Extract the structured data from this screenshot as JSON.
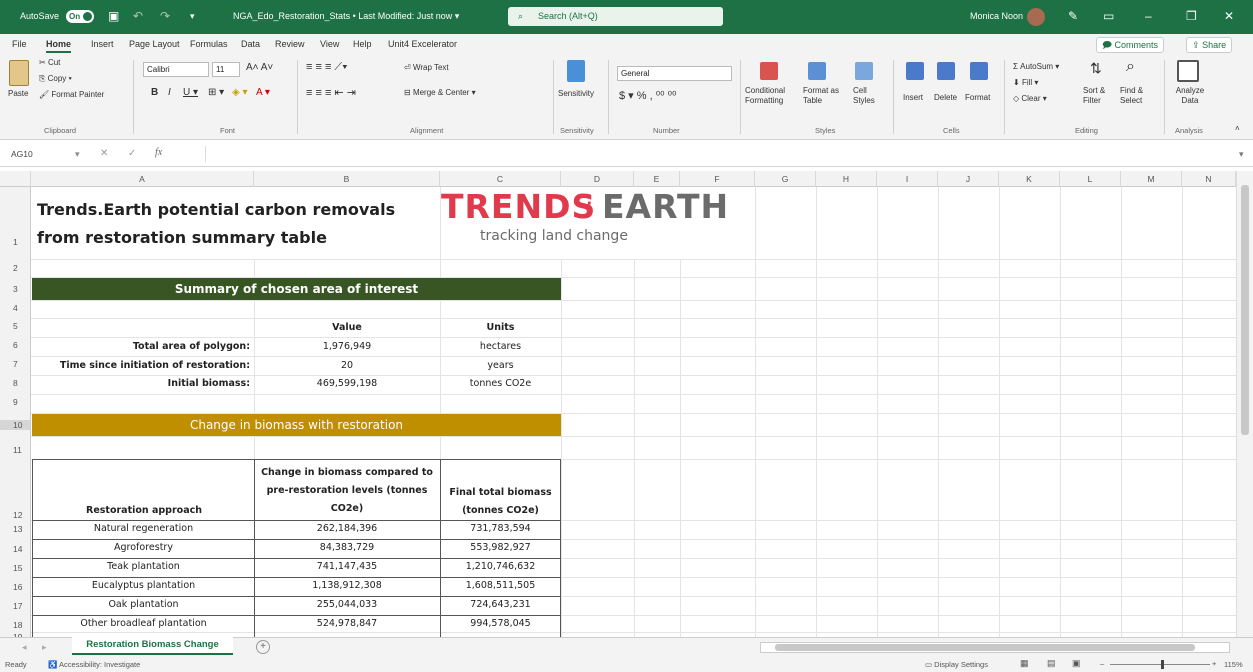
{
  "titlebar": {
    "autosave_label": "AutoSave",
    "autosave_state": "On",
    "doc_title": "NGA_Edo_Restoration_Stats • Last Modified: Just now",
    "search_placeholder": "Search (Alt+Q)",
    "user_name": "Monica Noon"
  },
  "menu": {
    "items": [
      "File",
      "Home",
      "Insert",
      "Page Layout",
      "Formulas",
      "Data",
      "Review",
      "View",
      "Help",
      "Unit4 Excelerator"
    ],
    "comments_label": "Comments",
    "share_label": "Share"
  },
  "ribbon": {
    "clipboard": {
      "paste": "Paste",
      "cut": "Cut",
      "copy": "Copy",
      "format_painter": "Format Painter",
      "group": "Clipboard"
    },
    "font": {
      "name": "Calibri",
      "size": "11",
      "group": "Font"
    },
    "alignment": {
      "wrap": "Wrap Text",
      "merge": "Merge & Center",
      "group": "Alignment"
    },
    "sensitivity": {
      "label": "Sensitivity",
      "group": "Sensitivity"
    },
    "number": {
      "format": "General",
      "group": "Number"
    },
    "styles": {
      "conditional": "Conditional Formatting",
      "format_table": "Format as Table",
      "cell_styles": "Cell Styles",
      "group": "Styles"
    },
    "cells": {
      "insert": "Insert",
      "delete": "Delete",
      "format": "Format",
      "group": "Cells"
    },
    "editing": {
      "autosum": "AutoSum",
      "fill": "Fill",
      "clear": "Clear",
      "sort": "Sort & Filter",
      "find": "Find & Select",
      "group": "Editing"
    },
    "analysis": {
      "analyze": "Analyze Data",
      "group": "Analysis"
    }
  },
  "formula_bar": {
    "name_box": "AG10",
    "formula": ""
  },
  "columns": [
    "A",
    "B",
    "C",
    "D",
    "E",
    "F",
    "G",
    "H",
    "I",
    "J",
    "K",
    "L",
    "M",
    "N"
  ],
  "rows": [
    "1",
    "2",
    "3",
    "4",
    "5",
    "6",
    "7",
    "8",
    "9",
    "10",
    "11",
    "12",
    "13",
    "14",
    "15",
    "16",
    "17",
    "18",
    "19"
  ],
  "sheet": {
    "title_line1": "Trends.Earth potential carbon removals",
    "title_line2": "from restoration summary table",
    "logo_word1": "TRENDS",
    "logo_word2": "EARTH",
    "logo_tagline": "tracking land change",
    "summary_header": "Summary of chosen area of interest",
    "summary_cols": {
      "value": "Value",
      "units": "Units"
    },
    "summary_rows": [
      {
        "label": "Total area of polygon:",
        "value": "1,976,949",
        "units": "hectares"
      },
      {
        "label": "Time since initiation of restoration:",
        "value": "20",
        "units": "years"
      },
      {
        "label": "Initial biomass:",
        "value": "469,599,198",
        "units": "tonnes CO2e"
      }
    ],
    "change_header": "Change in biomass with restoration",
    "change_cols": {
      "approach": "Restoration approach",
      "change": "Change in biomass compared to pre-restoration levels (tonnes CO2e)",
      "final": "Final total biomass (tonnes CO2e)"
    },
    "change_rows": [
      {
        "approach": "Natural regeneration",
        "change": "262,184,396",
        "final": "731,783,594"
      },
      {
        "approach": "Agroforestry",
        "change": "84,383,729",
        "final": "553,982,927"
      },
      {
        "approach": "Teak plantation",
        "change": "741,147,435",
        "final": "1,210,746,632"
      },
      {
        "approach": "Eucalyptus plantation",
        "change": "1,138,912,308",
        "final": "1,608,511,505"
      },
      {
        "approach": "Oak plantation",
        "change": "255,044,033",
        "final": "724,643,231"
      },
      {
        "approach": "Other broadleaf plantation",
        "change": "524,978,847",
        "final": "994,578,045"
      }
    ]
  },
  "tabs": {
    "active": "Restoration Biomass Change",
    "add": "+"
  },
  "status": {
    "ready": "Ready",
    "accessibility": "Accessibility: Investigate",
    "display": "Display Settings",
    "zoom": "115%"
  },
  "colors": {
    "excel_green": "#1e7145",
    "header_green": "#375623",
    "header_gold": "#bf8f00",
    "logo_red": "#e03a4c",
    "logo_gray": "#6b6b6b"
  }
}
